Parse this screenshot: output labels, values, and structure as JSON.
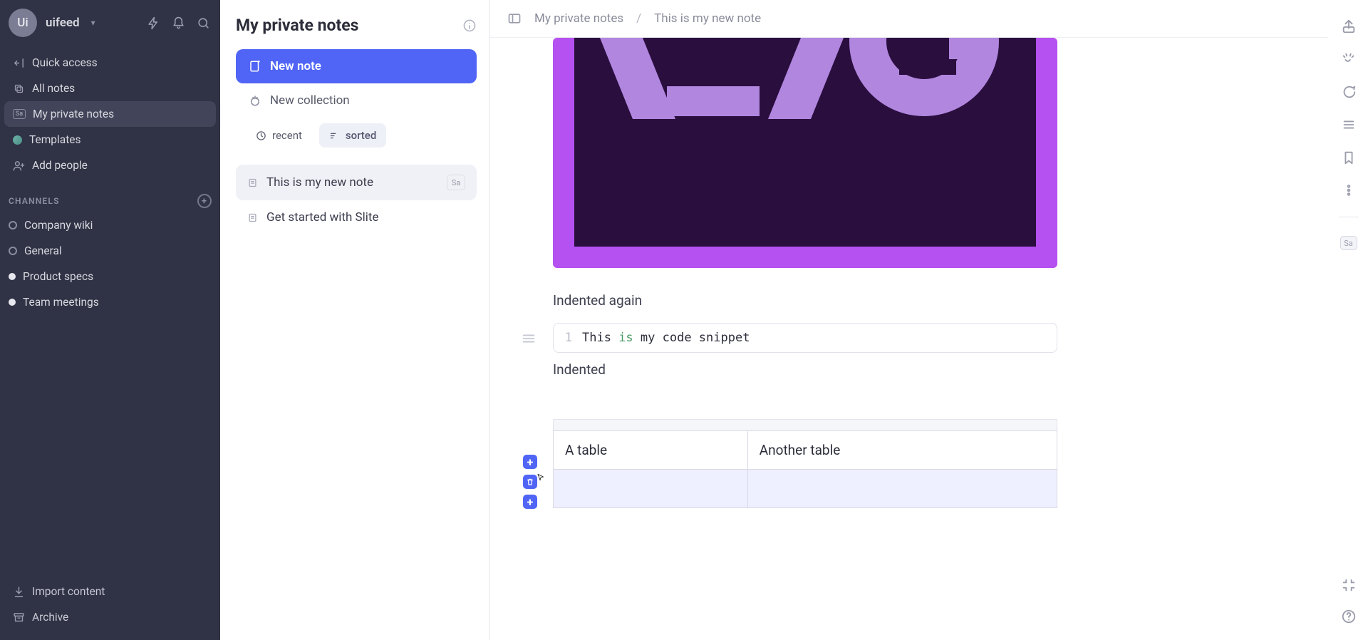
{
  "workspace": {
    "avatar_initials": "Ui",
    "name": "uifeed"
  },
  "sidebar": {
    "quick_access": "Quick access",
    "all_notes": "All notes",
    "private_notes": "My private notes",
    "private_tag": "Sa",
    "templates": "Templates",
    "add_people": "Add people",
    "section_channels": "CHANNELS",
    "channels": [
      {
        "label": "Company wiki",
        "style": "open"
      },
      {
        "label": "General",
        "style": "open"
      },
      {
        "label": "Product specs",
        "style": "full"
      },
      {
        "label": "Team meetings",
        "style": "full"
      }
    ],
    "import": "Import content",
    "archive": "Archive"
  },
  "mid": {
    "title": "My private notes",
    "new_note": "New note",
    "new_collection": "New collection",
    "filter_recent": "recent",
    "filter_sorted": "sorted",
    "notes": [
      {
        "label": "This is my new note",
        "tag": "Sa",
        "selected": true
      },
      {
        "label": "Get started with Slite",
        "tag": "",
        "selected": false
      }
    ]
  },
  "crumbs": {
    "root": "My private notes",
    "sep": "/",
    "leaf": "This is my new note"
  },
  "doc": {
    "para_indented_again": "Indented again",
    "code_line_no": "1",
    "code_t1": "This ",
    "code_kw": "is",
    "code_t2": " my code snippet",
    "para_indented": "Indented",
    "table": {
      "r1c1": "A table",
      "r1c2": "Another table",
      "r2c1": "",
      "r2c2": ""
    },
    "row_add": "+",
    "row_add2": "+"
  },
  "rail": {
    "user_tag": "Sa"
  }
}
